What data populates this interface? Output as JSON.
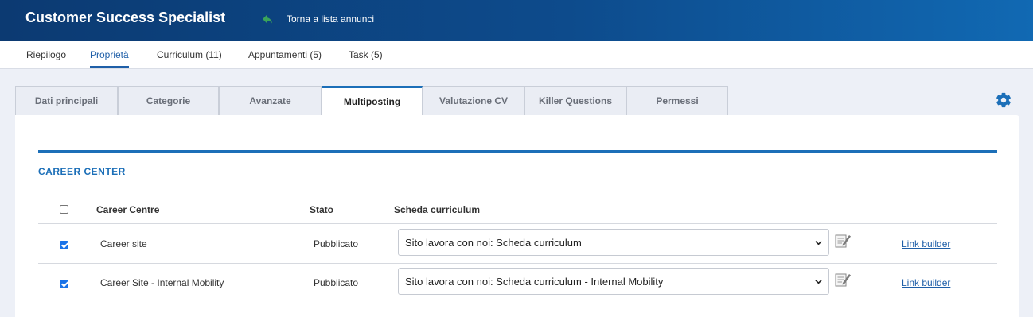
{
  "header": {
    "title": "Customer Success Specialist",
    "back_label": "Torna a lista annunci",
    "back_icon": "reply-arrow-icon"
  },
  "subnav": {
    "items": [
      "Riepilogo",
      "Proprietà",
      "Curriculum (11)",
      "Appuntamenti (5)",
      "Task (5)"
    ],
    "active": "Proprietà"
  },
  "tabs": {
    "items": [
      "Dati principali",
      "Categorie",
      "Avanzate",
      "Multiposting",
      "Valutazione CV",
      "Killer Questions",
      "Permessi"
    ],
    "active": "Multiposting"
  },
  "section": {
    "title": "CAREER CENTER"
  },
  "table": {
    "headers": {
      "career_centre": "Career Centre",
      "stato": "Stato",
      "scheda": "Scheda curriculum"
    },
    "select_all_checked": false,
    "rows": [
      {
        "checked": true,
        "name": "Career site",
        "stato": "Pubblicato",
        "scheda": "Sito lavora con noi: Scheda curriculum",
        "link": "Link builder"
      },
      {
        "checked": true,
        "name": "Career Site - Internal Mobility",
        "stato": "Pubblicato",
        "scheda": "Sito lavora con noi: Scheda curriculum - Internal Mobility",
        "link": "Link builder"
      }
    ]
  },
  "colors": {
    "accent": "#1c6fb8",
    "header_dark": "#0c3a72",
    "checkbox": "#1a73e8",
    "back_arrow": "#3aa35a"
  }
}
